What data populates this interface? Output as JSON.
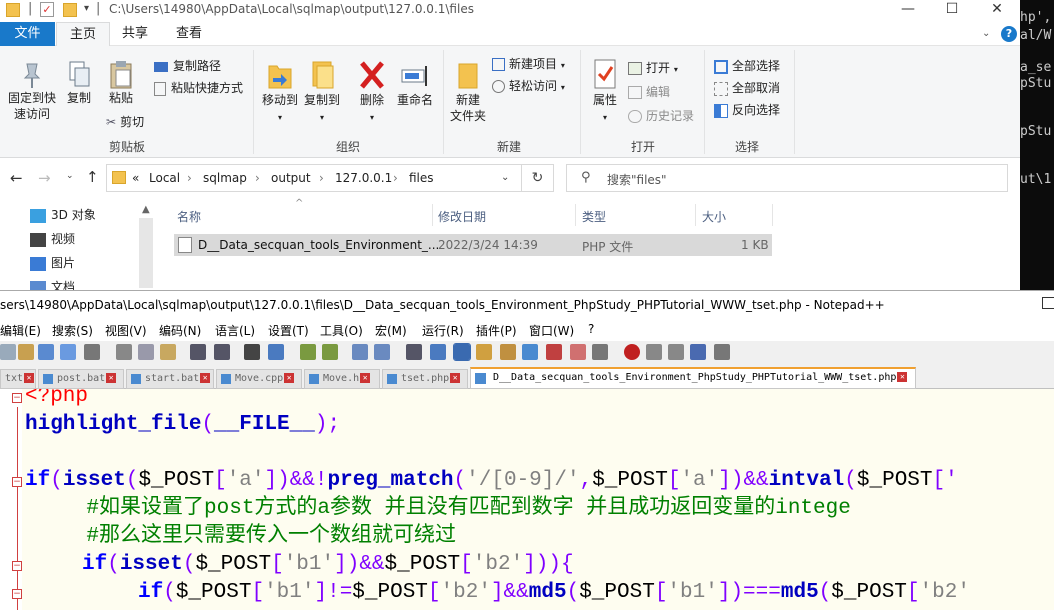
{
  "terminal": {
    "lines": [
      "hp',",
      "al/W",
      "a_se",
      "pStu",
      "pStu",
      "ut\\1"
    ]
  },
  "explorer": {
    "title_path": "C:\\Users\\14980\\AppData\\Local\\sqlmap\\output\\127.0.0.1\\files",
    "window_controls": {
      "minimize": "—",
      "maximize": "☐",
      "close": "✕"
    },
    "ribbon_tabs": [
      "文件",
      "主页",
      "共享",
      "查看"
    ],
    "help_icon": "?",
    "clipboard": {
      "pin": "固定到快\n速访问",
      "copy": "复制",
      "paste": "粘贴",
      "copy_path": "复制路径",
      "paste_shortcut": "粘贴快捷方式",
      "cut": "剪切",
      "label": "剪贴板"
    },
    "organize": {
      "move_to": "移动到",
      "copy_to": "复制到",
      "delete": "删除",
      "rename": "重命名",
      "label": "组织"
    },
    "new": {
      "new_folder": "新建\n文件夹",
      "new_item": "新建项目",
      "easy_access": "轻松访问",
      "label": "新建"
    },
    "open": {
      "properties": "属性",
      "open": "打开",
      "edit": "编辑",
      "history": "历史记录",
      "label": "打开"
    },
    "select": {
      "select_all": "全部选择",
      "select_none": "全部取消",
      "invert": "反向选择",
      "label": "选择"
    },
    "breadcrumb": [
      "Local",
      "sqlmap",
      "output",
      "127.0.0.1",
      "files"
    ],
    "breadcrumb_prefix": "«",
    "search_placeholder": "搜索\"files\"",
    "nav": [
      {
        "label": "3D 对象",
        "color": "#3aa0e0"
      },
      {
        "label": "视频",
        "color": "#444"
      },
      {
        "label": "图片",
        "color": "#3a7bd5"
      },
      {
        "label": "文档",
        "color": "#5a8ad0"
      }
    ],
    "columns": [
      "名称",
      "修改日期",
      "类型",
      "大小"
    ],
    "file": {
      "name": "D__Data_secquan_tools_Environment_...",
      "modified": "2022/3/24 14:39",
      "type": "PHP 文件",
      "size": "1 KB"
    }
  },
  "notepad": {
    "title": "sers\\14980\\AppData\\Local\\sqlmap\\output\\127.0.0.1\\files\\D__Data_secquan_tools_Environment_PhpStudy_PHPTutorial_WWW_tset.php - Notepad++",
    "menu": [
      "编辑(E)",
      "搜索(S)",
      "视图(V)",
      "编码(N)",
      "语言(L)",
      "设置(T)",
      "工具(O)",
      "宏(M)",
      "运行(R)",
      "插件(P)",
      "窗口(W)",
      "?"
    ],
    "tabs": [
      "txt",
      "post.bat",
      "start.bat",
      "Move.cpp",
      "Move.h",
      "tset.php",
      "D__Data_secquan_tools_Environment_PhpStudy_PHPTutorial_WWW_tset.php"
    ],
    "code": {
      "l1": "<?php",
      "l2a": "highlight_file",
      "l2b": "(",
      "l2c": "__FILE__",
      "l2d": ");",
      "l4_if": "if",
      "l4_p1": "(",
      "l4_isset": "isset",
      "l4_p2": "(",
      "l4_post1": "$_POST",
      "l4_b1": "[",
      "l4_s1": "'a'",
      "l4_b2": "])&&!",
      "l4_pm": "preg_match",
      "l4_p3": "(",
      "l4_s2": "'/[0-9]/'",
      "l4_c": ",",
      "l4_post2": "$_POST",
      "l4_b3": "[",
      "l4_s3": "'a'",
      "l4_b4": "])&&",
      "l4_iv": "intval",
      "l4_p4": "(",
      "l4_post3": "$_POST",
      "l4_b5": "['",
      "l5": "    #如果设置了post方式的a参数 并且没有匹配到数字 并且成功返回变量的intege",
      "l6": "    #那么这里只需要传入一个数组就可绕过",
      "l7_if": "if",
      "l7_p1": "(",
      "l7_isset": "isset",
      "l7_p2": "(",
      "l7_post1": "$_POST",
      "l7_b1": "[",
      "l7_s1": "'b1'",
      "l7_b2": "])&&",
      "l7_post2": "$_POST",
      "l7_b3": "[",
      "l7_s2": "'b2'",
      "l7_b4": "])){",
      "l8_if": "if",
      "l8_p1": "(",
      "l8_post1": "$_POST",
      "l8_b1": "[",
      "l8_s1": "'b1'",
      "l8_b2": "]!=",
      "l8_post2": "$_POST",
      "l8_b3": "[",
      "l8_s2": "'b2'",
      "l8_b4": "]&&",
      "l8_md5a": "md5",
      "l8_p2": "(",
      "l8_post3": "$_POST",
      "l8_b5": "[",
      "l8_s3": "'b1'",
      "l8_b6": "])===",
      "l8_md5b": "md5",
      "l8_p3": "(",
      "l8_post4": "$_POST",
      "l8_b7": "[",
      "l8_s4": "'b2'"
    }
  }
}
